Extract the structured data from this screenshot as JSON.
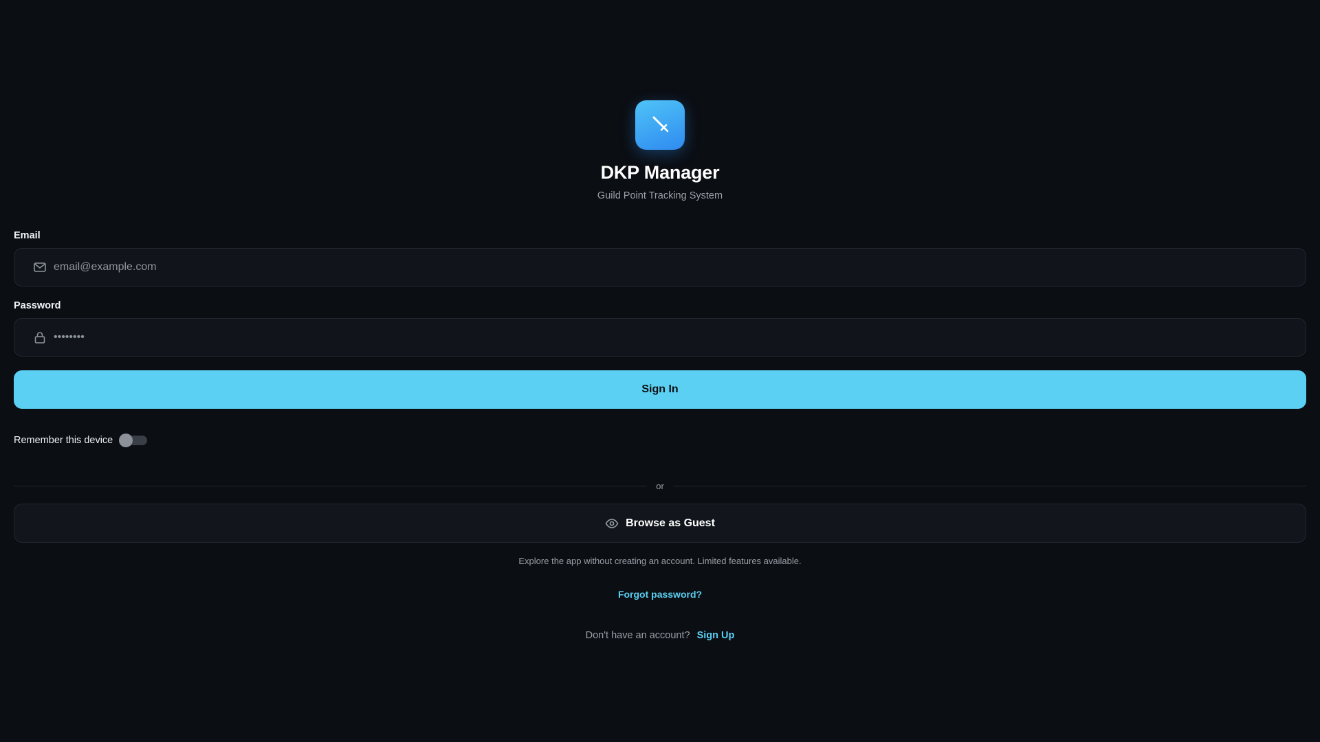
{
  "app": {
    "title": "DKP Manager",
    "subtitle": "Guild Point Tracking System",
    "logo_icon": "sword-icon",
    "accent_color": "#5bd0f2",
    "background_color": "#0b0e13"
  },
  "form": {
    "email_label": "Email",
    "email_placeholder": "email@example.com",
    "email_value": "",
    "email_icon": "mail-icon",
    "password_label": "Password",
    "password_value": "••••••••",
    "password_icon": "lock-icon",
    "signin_label": "Sign In",
    "remember_label": "Remember this device",
    "remember_enabled": false
  },
  "divider": {
    "text": "or"
  },
  "guest": {
    "label": "Browse as Guest",
    "icon": "eye-icon",
    "note": "Explore the app without creating an account. Limited features available."
  },
  "links": {
    "forgot_password": "Forgot password?",
    "signup_prompt": "Don't have an account?",
    "signup_label": "Sign Up"
  }
}
